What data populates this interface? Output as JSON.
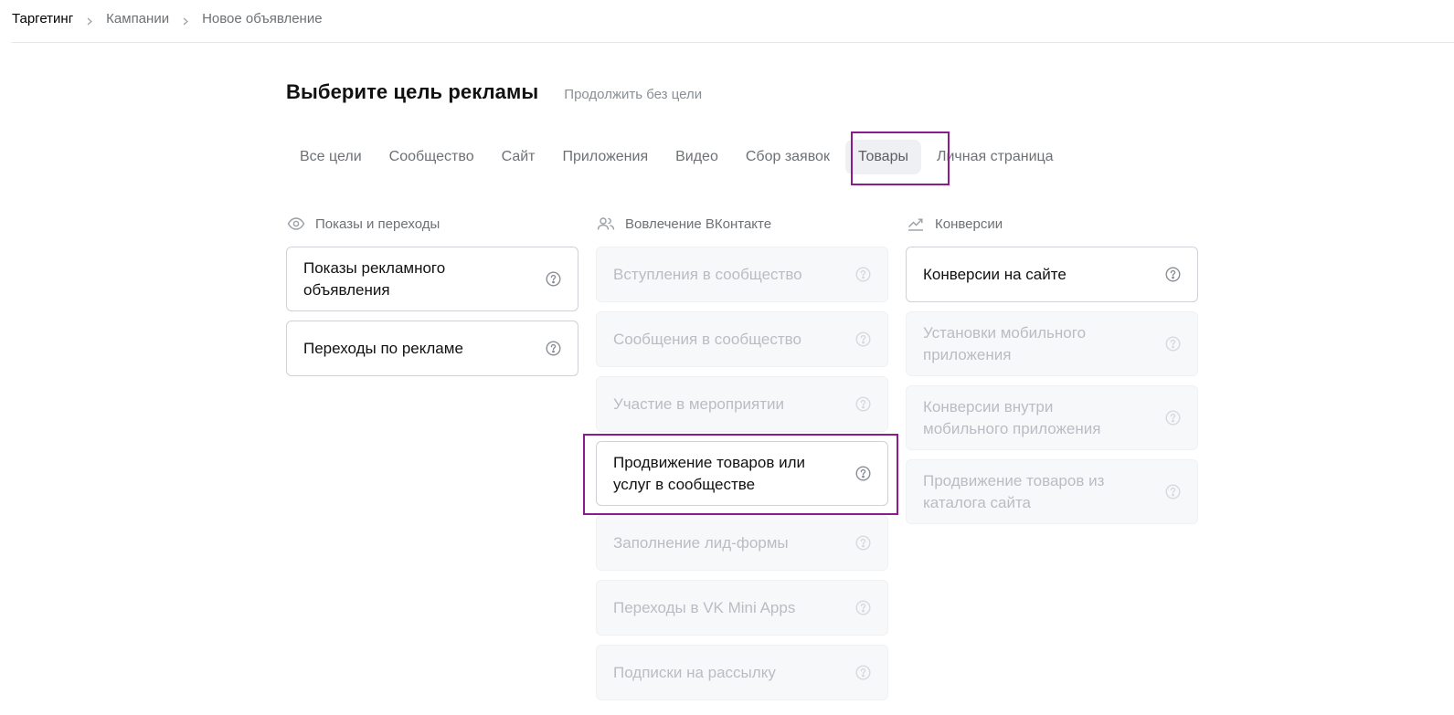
{
  "breadcrumb": {
    "items": [
      "Таргетинг",
      "Кампании",
      "Новое объявление"
    ]
  },
  "header": {
    "title": "Выберите цель рекламы",
    "skip_link": "Продолжить без цели"
  },
  "tabs": [
    {
      "label": "Все цели",
      "active": false
    },
    {
      "label": "Сообщество",
      "active": false
    },
    {
      "label": "Сайт",
      "active": false
    },
    {
      "label": "Приложения",
      "active": false
    },
    {
      "label": "Видео",
      "active": false
    },
    {
      "label": "Сбор заявок",
      "active": false
    },
    {
      "label": "Товары",
      "active": true
    },
    {
      "label": "Личная страница",
      "active": false
    }
  ],
  "columns": [
    {
      "title": "Показы и переходы",
      "icon": "eye-icon",
      "cards": [
        {
          "label": "Показы рекламного объявления",
          "enabled": true
        },
        {
          "label": "Переходы по рекламе",
          "enabled": true
        }
      ]
    },
    {
      "title": "Вовлечение ВКонтакте",
      "icon": "users-icon",
      "cards": [
        {
          "label": "Вступления в сообщество",
          "enabled": false
        },
        {
          "label": "Сообщения в сообщество",
          "enabled": false
        },
        {
          "label": "Участие в мероприятии",
          "enabled": false
        },
        {
          "label": "Продвижение товаров или услуг в сообществе",
          "enabled": true
        },
        {
          "label": "Заполнение лид-формы",
          "enabled": false
        },
        {
          "label": "Переходы в VK Mini Apps",
          "enabled": false
        },
        {
          "label": "Подписки на рассылку",
          "enabled": false
        }
      ]
    },
    {
      "title": "Конверсии",
      "icon": "trend-up-icon",
      "cards": [
        {
          "label": "Конверсии на сайте",
          "enabled": true
        },
        {
          "label": "Установки мобильного приложения",
          "enabled": false
        },
        {
          "label": "Конверсии внутри мобильного приложения",
          "enabled": false
        },
        {
          "label": "Продвижение товаров из каталога сайта",
          "enabled": false
        }
      ]
    }
  ],
  "colors": {
    "highlight": "#8a1c8f",
    "text_primary": "#111111",
    "text_secondary": "#6d7175",
    "text_disabled": "#b9bdc3",
    "active_tab_bg": "#eef0f3"
  }
}
